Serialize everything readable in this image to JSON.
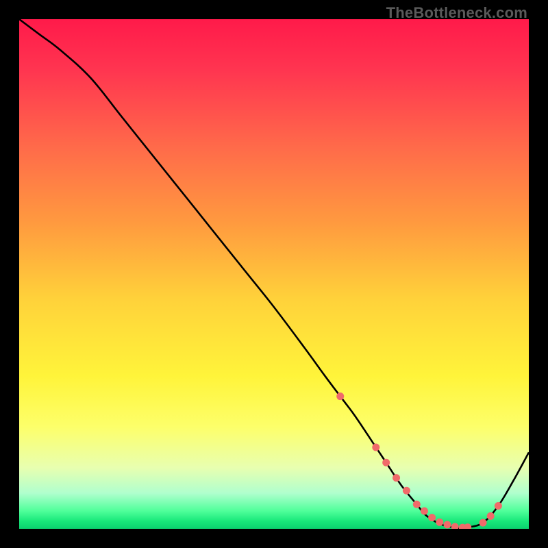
{
  "watermark": "TheBottleneck.com",
  "chart_data": {
    "type": "line",
    "title": "",
    "xlabel": "",
    "ylabel": "",
    "xlim": [
      0,
      100
    ],
    "ylim": [
      0,
      100
    ],
    "grid": false,
    "legend": false,
    "background_gradient": {
      "stops": [
        {
          "offset": 0.0,
          "color": "#ff1a4a"
        },
        {
          "offset": 0.1,
          "color": "#ff3550"
        },
        {
          "offset": 0.25,
          "color": "#ff6a4a"
        },
        {
          "offset": 0.4,
          "color": "#ff9a3f"
        },
        {
          "offset": 0.55,
          "color": "#ffd23a"
        },
        {
          "offset": 0.7,
          "color": "#fff43a"
        },
        {
          "offset": 0.8,
          "color": "#fdff6a"
        },
        {
          "offset": 0.88,
          "color": "#e8ffb0"
        },
        {
          "offset": 0.93,
          "color": "#b0ffce"
        },
        {
          "offset": 0.965,
          "color": "#4fff9a"
        },
        {
          "offset": 0.985,
          "color": "#18e87a"
        },
        {
          "offset": 1.0,
          "color": "#0bd06f"
        }
      ]
    },
    "series": [
      {
        "name": "bottleneck-curve",
        "color": "#000000",
        "width": 2.6,
        "x": [
          0,
          4,
          8,
          14,
          20,
          26,
          32,
          38,
          44,
          50,
          56,
          60,
          63,
          66,
          70,
          72,
          75,
          78,
          80,
          83,
          86,
          88,
          91,
          94,
          97,
          100
        ],
        "y": [
          100,
          97,
          94,
          88.5,
          81,
          73.5,
          66,
          58.5,
          51,
          43.5,
          35.5,
          30,
          26,
          22,
          16,
          13,
          8.5,
          4.8,
          2.5,
          0.8,
          0.2,
          0.3,
          1.2,
          4.5,
          9.5,
          15
        ]
      }
    ],
    "markers": {
      "name": "highlight-points",
      "color": "#f06a6a",
      "radius": 5.5,
      "x": [
        63,
        70,
        72,
        74,
        76,
        78,
        79.5,
        81,
        82.5,
        84,
        85.5,
        87,
        88,
        91,
        92.5,
        94
      ],
      "y": [
        26,
        16,
        13,
        10,
        7.5,
        4.8,
        3.5,
        2.2,
        1.3,
        0.8,
        0.4,
        0.25,
        0.3,
        1.2,
        2.5,
        4.5
      ]
    }
  }
}
